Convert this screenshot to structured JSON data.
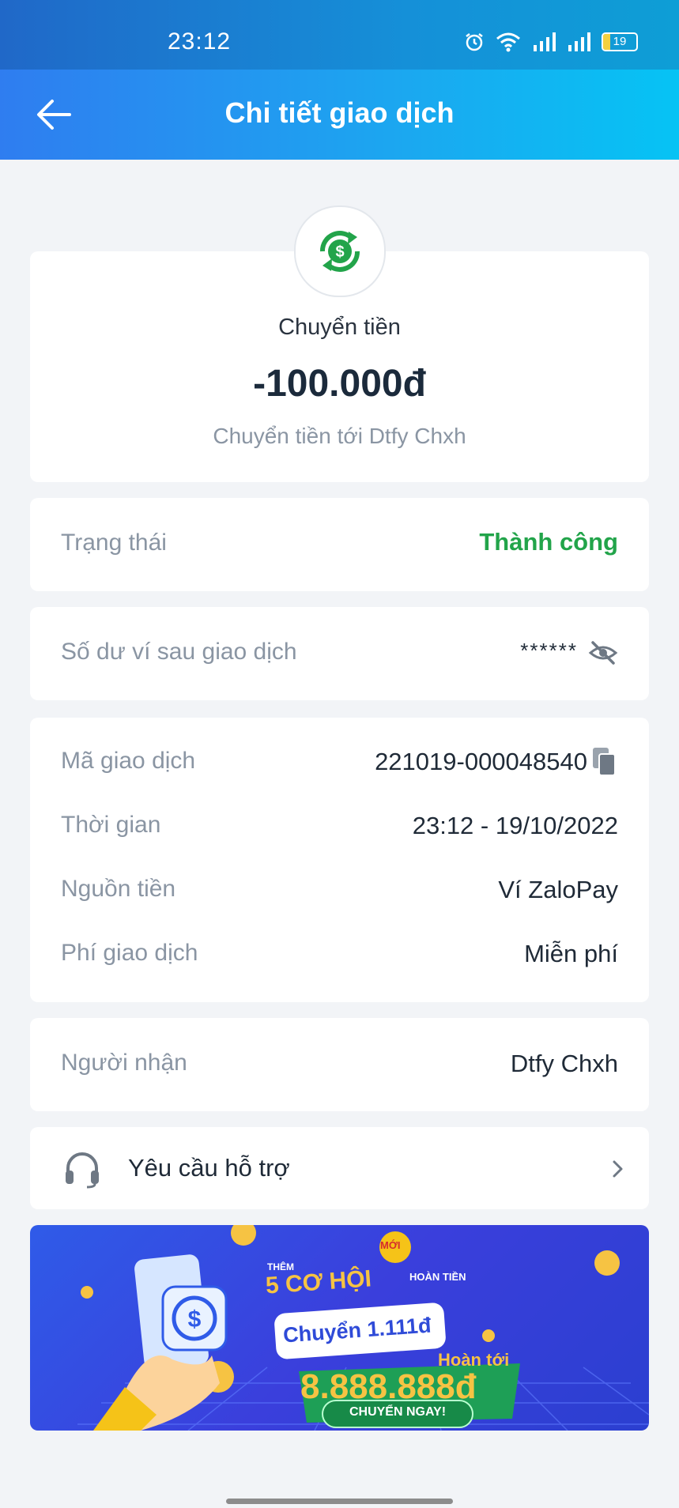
{
  "status_bar": {
    "time": "23:12",
    "battery": "19"
  },
  "nav": {
    "title": "Chi tiết giao dịch",
    "back_icon": "arrow-left-icon"
  },
  "summary": {
    "type_label": "Chuyển tiền",
    "amount": "-100.000đ",
    "description": "Chuyển tiền tới Dtfy Chxh",
    "icon": "money-transfer-icon",
    "icon_color": "#22a44a"
  },
  "status_row": {
    "label": "Trạng thái",
    "value": "Thành công",
    "value_color": "#22a44a"
  },
  "balance_row": {
    "label": "Số dư ví sau giao dịch",
    "value": "******",
    "icon": "eye-off-icon"
  },
  "details": {
    "rows": [
      {
        "label": "Mã giao dịch",
        "value": "221019-000048540"
      },
      {
        "label": "Thời gian",
        "value": "23:12 - 19/10/2022"
      },
      {
        "label": "Nguồn tiền",
        "value": "Ví ZaloPay"
      },
      {
        "label": "Phí giao dịch",
        "value": "Miễn phí"
      }
    ],
    "copy_icon": "copy-icon"
  },
  "recipient_row": {
    "label": "Người nhận",
    "value": "Dtfy Chxh"
  },
  "support": {
    "label": "Yêu cầu hỗ trợ",
    "icon": "headset-icon",
    "chevron": "chevron-right-icon"
  },
  "banner": {
    "badge": "MỚI",
    "small_top": "THÊM",
    "headline": "5 CƠ HỘI",
    "small_right": "HOÀN TIỀN",
    "transfer_text": "Chuyển 1.111đ",
    "refund_label": "Hoàn tới",
    "refund_amount": "8.888.888đ",
    "cta": "CHUYỂN NGAY!"
  }
}
